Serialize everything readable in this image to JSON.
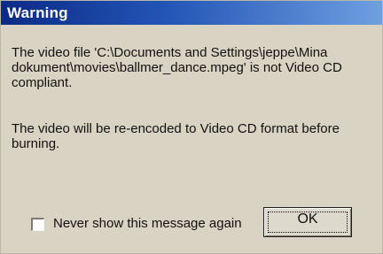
{
  "window": {
    "title": "Warning"
  },
  "message": {
    "line1": "The video file 'C:\\Documents and Settings\\jeppe\\Mina dokument\\movies\\ballmer_dance.mpeg' is not Video CD compliant.",
    "line2": "The video will be re-encoded to Video CD format before burning."
  },
  "checkbox": {
    "label": "Never show this message again",
    "checked": false
  },
  "button": {
    "ok_label": "OK"
  },
  "colors": {
    "titlebar_dark": "#0c2a86",
    "titlebar_light": "#6f9fe0",
    "dialog_background": "#d8d3c3"
  }
}
